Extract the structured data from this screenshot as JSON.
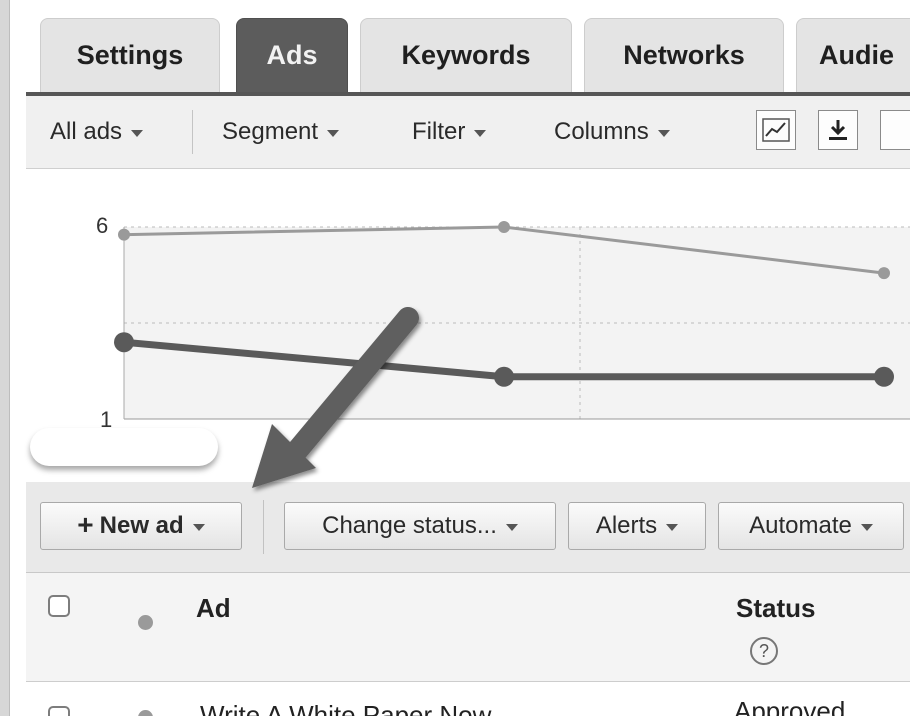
{
  "tabs": [
    {
      "label": "Settings",
      "active": false
    },
    {
      "label": "Ads",
      "active": true
    },
    {
      "label": "Keywords",
      "active": false
    },
    {
      "label": "Networks",
      "active": false
    },
    {
      "label": "Audie",
      "active": false
    }
  ],
  "toolbar": {
    "all_ads": "All ads",
    "segment": "Segment",
    "filter": "Filter",
    "columns": "Columns",
    "icons": [
      "line-chart-icon",
      "download-icon",
      "more-icon"
    ]
  },
  "chart_data": {
    "type": "line",
    "ytick_labels": [
      "6",
      "1"
    ],
    "ylim": [
      1,
      6
    ],
    "x": [
      0,
      1,
      2
    ],
    "grid": true,
    "series": [
      {
        "values": [
          5.8,
          6.0,
          4.8
        ],
        "color": "#9a9a9a"
      },
      {
        "values": [
          3.0,
          2.1,
          2.1
        ],
        "color": "#5a5a5a"
      }
    ]
  },
  "actions": {
    "new_ad": "New ad",
    "change_status": "Change status...",
    "alerts": "Alerts",
    "automate": "Automate"
  },
  "table": {
    "headers": {
      "ad": "Ad",
      "status": "Status",
      "help": "?"
    },
    "rows": [
      {
        "ad": "Write A White Paper Now",
        "status": "Approved"
      }
    ]
  },
  "colors": {
    "active_tab": "#5c5c5c",
    "arrow": "#5e5e5e"
  }
}
